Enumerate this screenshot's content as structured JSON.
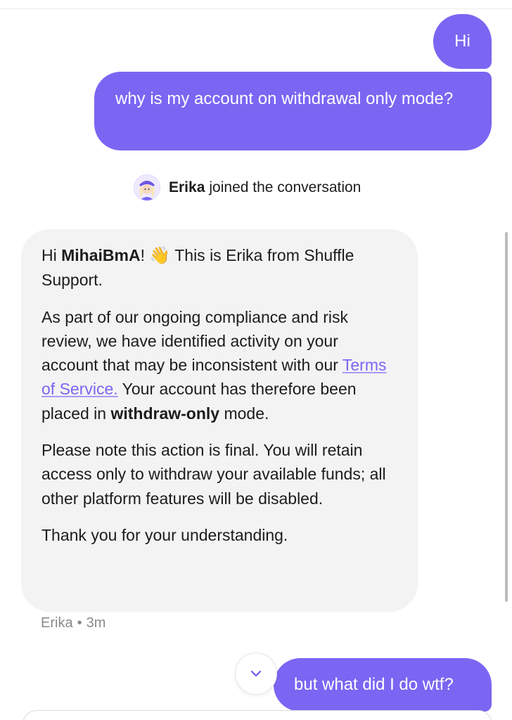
{
  "messages": {
    "user_1": "Hi",
    "user_2": "why is my account on withdrawal only mode?",
    "user_3": "but what did I do wtf?"
  },
  "join_notice": {
    "name": "Erika",
    "text": "joined the conversation"
  },
  "agent_message": {
    "p1_prefix": "Hi ",
    "p1_username": "MihaiBmA",
    "p1_excl": "!",
    "p1_rest": " This is Erika from Shuffle Support.",
    "p2_a": "As part of our ongoing compliance and risk review, we have identified activity on your account that may be inconsistent with our ",
    "p2_link": "Terms of Service.",
    "p2_b": " Your account has therefore been placed in ",
    "p2_bold": "withdraw-only",
    "p2_c": " mode.",
    "p3": "Please note this action is final. You will retain access only to withdraw your available funds; all other platform features will be disabled.",
    "p4": "Thank you for your understanding."
  },
  "message_meta": {
    "author": "Erika",
    "separator": "•",
    "time": "3m"
  },
  "icons": {
    "wave": "waving-hand-emoji",
    "scroll_down": "chevron-down-icon"
  },
  "colors": {
    "user_bubble": "#7a66f2",
    "agent_bubble": "#f3f3f4",
    "link": "#7a66f2"
  }
}
